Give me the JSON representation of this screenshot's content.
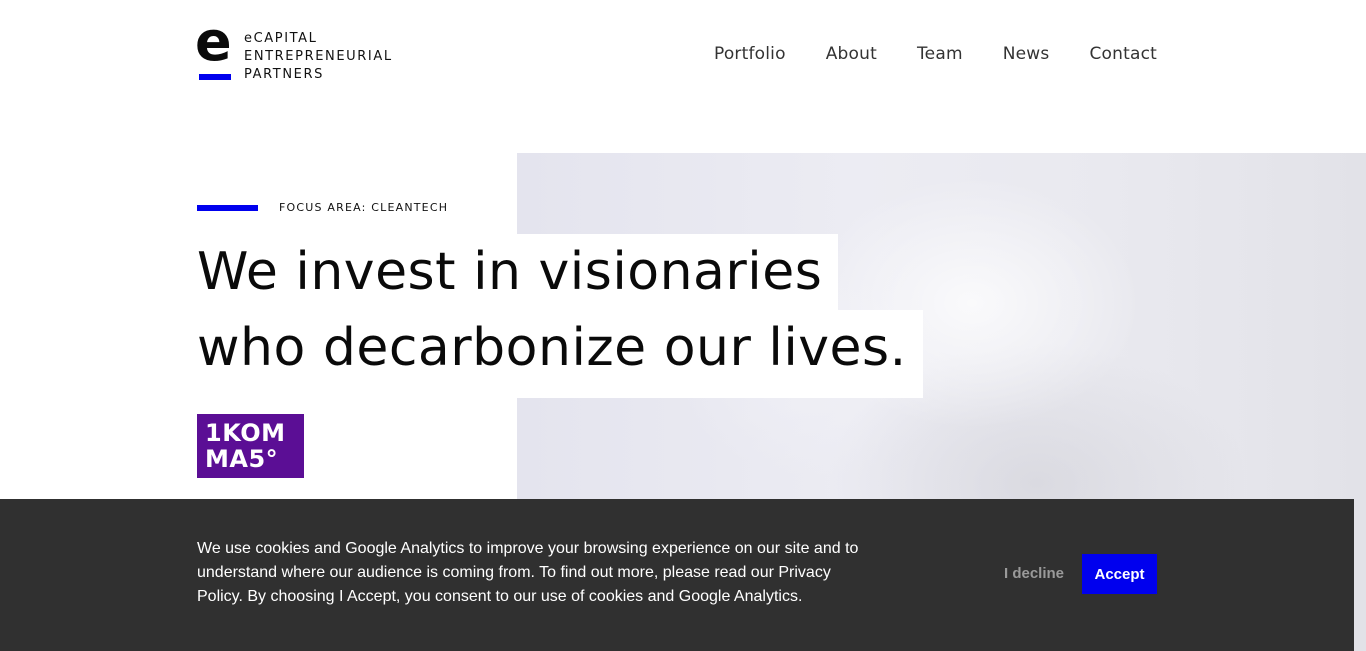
{
  "header": {
    "logo": {
      "mark": "e",
      "lines": [
        "eCAPITAL",
        "ENTREPRENEURIAL",
        "PARTNERS"
      ],
      "accent_color": "#0000ee"
    },
    "nav": [
      {
        "label": "Portfolio"
      },
      {
        "label": "About"
      },
      {
        "label": "Team"
      },
      {
        "label": "News"
      },
      {
        "label": "Contact"
      }
    ]
  },
  "hero": {
    "focus_label": "FOCUS AREA: CLEANTECH",
    "headline": [
      "We invest in visionaries",
      "who decarbonize our lives."
    ],
    "company_logo": {
      "lines": [
        "1KOM",
        "MA5°"
      ],
      "color": "#5b0e95"
    }
  },
  "cookie_banner": {
    "text": "We use cookies and Google Analytics to improve your browsing experience on our site and to understand where our audience is coming from. To find out more, please read our Privacy Policy. By choosing I Accept, you consent to our use of cookies and Google Analytics.",
    "decline_label": "I decline",
    "accept_label": "Accept",
    "background": "#303030"
  }
}
